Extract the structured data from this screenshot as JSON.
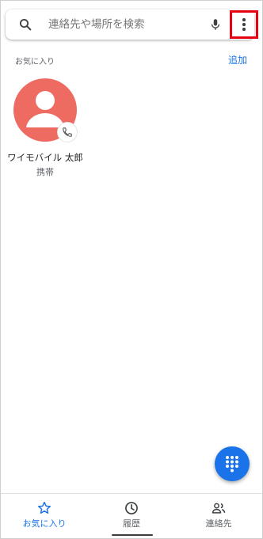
{
  "search": {
    "placeholder": "連絡先や場所を検索"
  },
  "favorites": {
    "section_label": "お気に入り",
    "add_label": "追加",
    "contacts": [
      {
        "name": "ワイモバイル 太郎",
        "type": "携帯",
        "avatar_color": "#ee6b62"
      }
    ]
  },
  "bottom_nav": {
    "items": [
      {
        "label": "お気に入り",
        "icon": "star-icon",
        "active": true
      },
      {
        "label": "履歴",
        "icon": "clock-icon",
        "active": false
      },
      {
        "label": "連絡先",
        "icon": "people-icon",
        "active": false
      }
    ]
  },
  "colors": {
    "accent": "#1a73e8",
    "highlight_box": "#e60012",
    "avatar": "#ee6b62"
  },
  "icons": {
    "search": "search-icon",
    "mic": "mic-icon",
    "more": "more-vert-icon",
    "call_badge": "phone-icon",
    "fab": "dialpad-icon"
  }
}
